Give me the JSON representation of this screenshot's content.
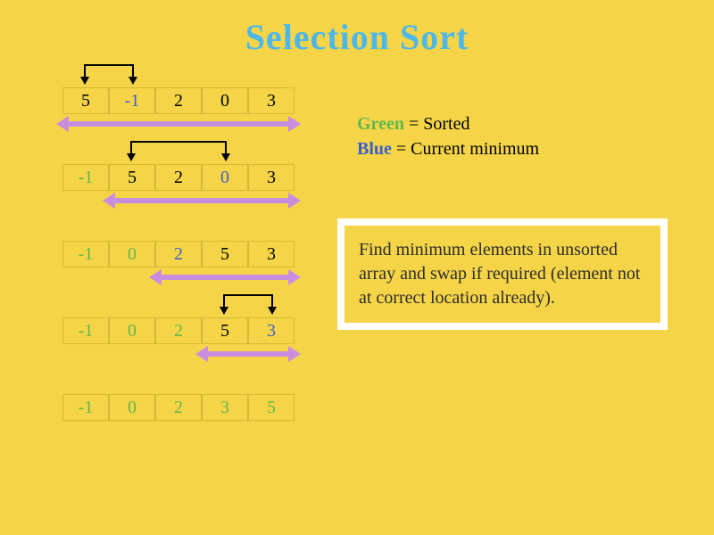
{
  "title": "Selection Sort",
  "legend": {
    "green_label": "Green",
    "green_rest": " = Sorted",
    "blue_label": "Blue",
    "blue_rest": " = Current minimum"
  },
  "description": "Find minimum elements in unsorted array and swap if required (element not at correct location already).",
  "colors": {
    "background": "#f5d547",
    "title": "#4db8e8",
    "sorted": "#5fb84d",
    "minimum": "#3d5ec9",
    "range_arrow": "#c98de0",
    "swap_arrow": "#000000",
    "cell_border": "#d4b838",
    "box_border": "#ffffff"
  },
  "chart_data": {
    "type": "table",
    "algorithm": "selection_sort",
    "cell_states": [
      "normal",
      "sorted",
      "minimum"
    ],
    "steps": [
      {
        "array": [
          {
            "v": "5",
            "state": "normal"
          },
          {
            "v": "-1",
            "state": "minimum"
          },
          {
            "v": "2",
            "state": "normal"
          },
          {
            "v": "0",
            "state": "normal"
          },
          {
            "v": "3",
            "state": "normal"
          }
        ],
        "swap": [
          0,
          1
        ],
        "range": [
          0,
          4
        ]
      },
      {
        "array": [
          {
            "v": "-1",
            "state": "sorted"
          },
          {
            "v": "5",
            "state": "normal"
          },
          {
            "v": "2",
            "state": "normal"
          },
          {
            "v": "0",
            "state": "minimum"
          },
          {
            "v": "3",
            "state": "normal"
          }
        ],
        "swap": [
          1,
          3
        ],
        "range": [
          1,
          4
        ]
      },
      {
        "array": [
          {
            "v": "-1",
            "state": "sorted"
          },
          {
            "v": "0",
            "state": "sorted"
          },
          {
            "v": "2",
            "state": "minimum"
          },
          {
            "v": "5",
            "state": "normal"
          },
          {
            "v": "3",
            "state": "normal"
          }
        ],
        "swap": null,
        "range": [
          2,
          4
        ]
      },
      {
        "array": [
          {
            "v": "-1",
            "state": "sorted"
          },
          {
            "v": "0",
            "state": "sorted"
          },
          {
            "v": "2",
            "state": "sorted"
          },
          {
            "v": "5",
            "state": "normal"
          },
          {
            "v": "3",
            "state": "minimum"
          }
        ],
        "swap": [
          3,
          4
        ],
        "range": [
          3,
          4
        ]
      },
      {
        "array": [
          {
            "v": "-1",
            "state": "sorted"
          },
          {
            "v": "0",
            "state": "sorted"
          },
          {
            "v": "2",
            "state": "sorted"
          },
          {
            "v": "3",
            "state": "sorted"
          },
          {
            "v": "5",
            "state": "sorted"
          }
        ],
        "swap": null,
        "range": null
      }
    ]
  }
}
